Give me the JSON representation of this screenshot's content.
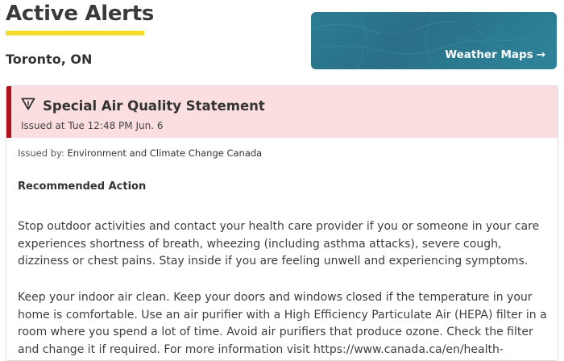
{
  "header": {
    "title": "Active Alerts",
    "location": "Toronto, ON"
  },
  "map_card": {
    "label": "Weather Maps",
    "arrow": "→"
  },
  "alert": {
    "title": "Special Air Quality Statement",
    "issued": "Issued at Tue 12:48 PM Jun. 6",
    "issuer_prefix": "Issued by:",
    "issuer": "Environment and Climate Change Canada",
    "section_heading": "Recommended Action",
    "paragraph1": "Stop outdoor activities and contact your health care provider if you or someone in your care experiences shortness of breath, wheezing (including asthma attacks), severe cough, dizziness or chest pains. Stay inside if you are feeling unwell and experiencing symptoms.",
    "paragraph2": "Keep your indoor air clean. Keep your doors and windows closed if the temperature in your home is comfortable. Use an air purifier with a High Efficiency Particulate Air (HEPA) filter in a room where you spend a lot of time. Avoid air purifiers that produce ozone. Check the filter and change it if required. For more information visit https://www.canada.ca/en/health-"
  },
  "colors": {
    "title_underline": "#f2dc2e",
    "alert_accent": "#b0131d",
    "alert_background": "#fbdedf",
    "map_card": "#2b7d93"
  },
  "icons": {
    "alert": "warning-triangle-icon",
    "map_arrow": "arrow-right-icon"
  }
}
